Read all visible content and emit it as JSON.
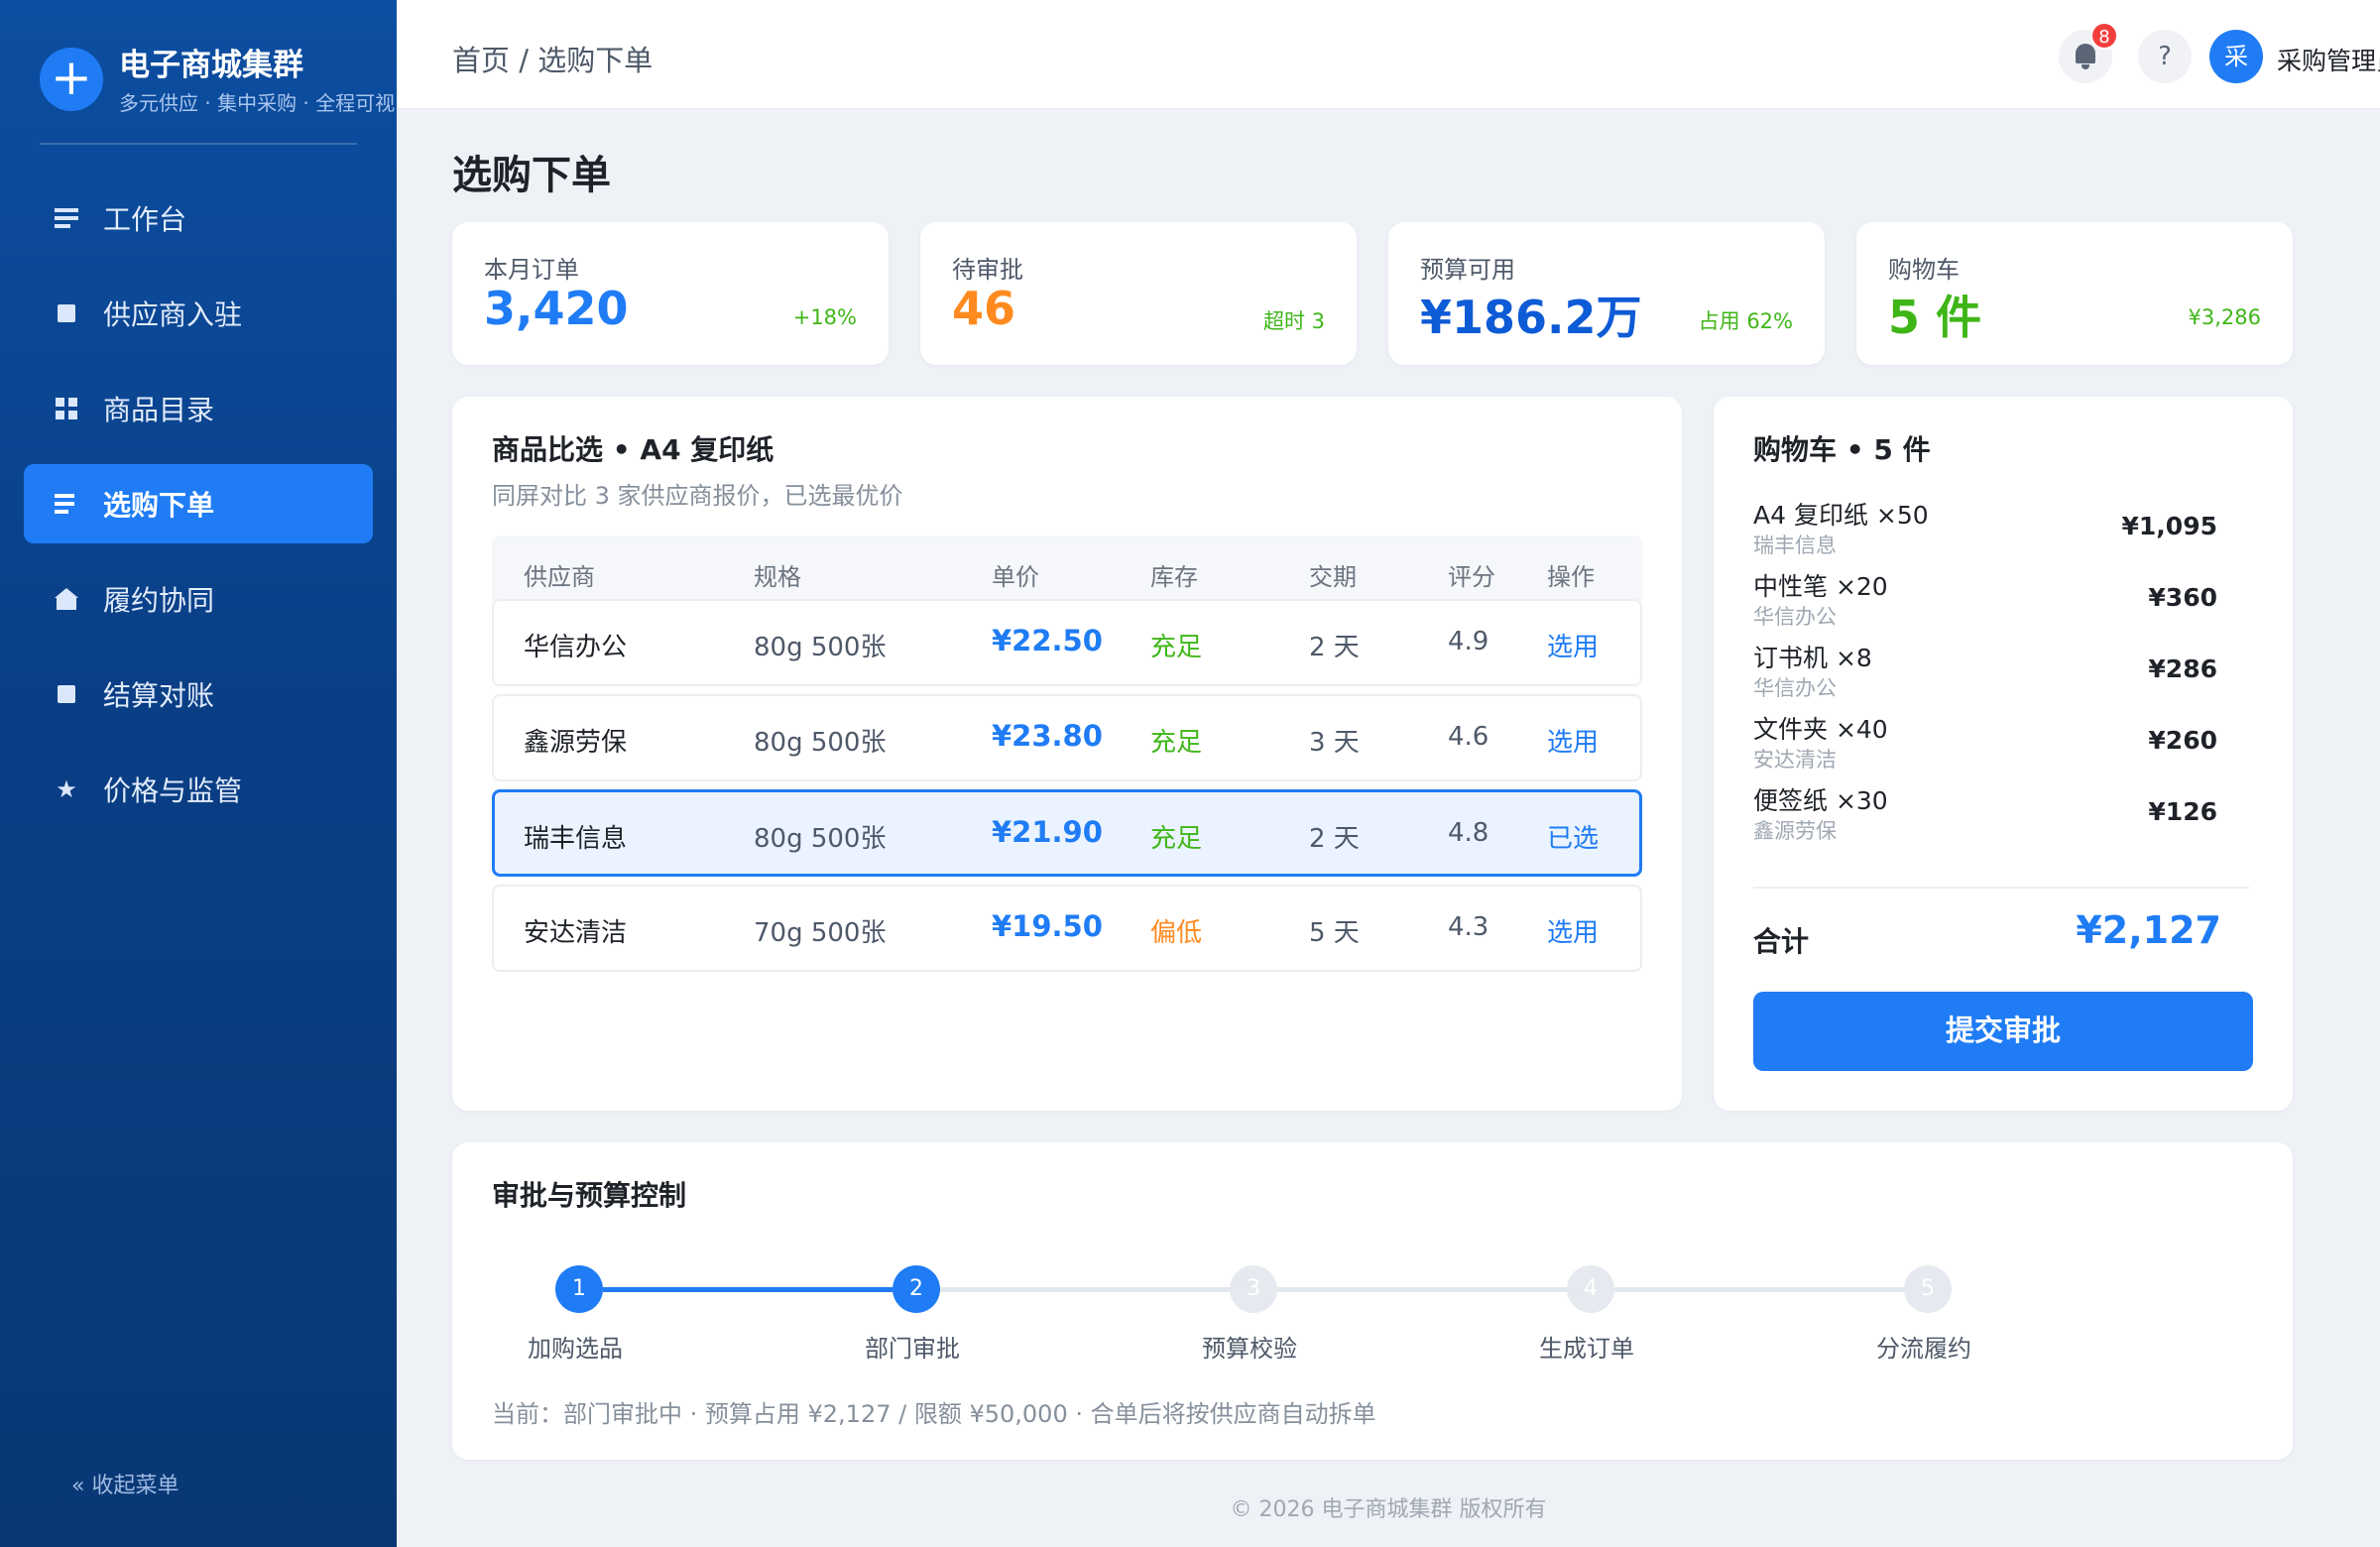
{
  "brand": {
    "title": "电子商城集群",
    "subtitle": "多元供应 · 集中采购 · 全程可视",
    "logo": "+"
  },
  "nav": [
    {
      "label": "工作台",
      "icon": "list-icon"
    },
    {
      "label": "供应商入驻",
      "icon": "square-icon"
    },
    {
      "label": "商品目录",
      "icon": "grid-icon"
    },
    {
      "label": "选购下单",
      "icon": "list-icon",
      "active": true
    },
    {
      "label": "履约协同",
      "icon": "house-icon"
    },
    {
      "label": "结算对账",
      "icon": "square-icon"
    },
    {
      "label": "价格与监管",
      "icon": "star-icon"
    }
  ],
  "collapse_label": "« 收起菜单",
  "header": {
    "breadcrumb": "首页 / 选购下单",
    "notification_count": "8",
    "help": "?",
    "avatar_initial": "采",
    "username": "采购管理员"
  },
  "page_title": "选购下单",
  "stats": [
    {
      "label": "本月订单",
      "value": "3,420",
      "meta": "+18%",
      "value_color": "#1f7cf5",
      "meta_color": "#3fb618"
    },
    {
      "label": "待审批",
      "value": "46",
      "meta": "超时 3",
      "value_color": "#ff8a1f",
      "meta_color": "#3fb618"
    },
    {
      "label": "预算可用",
      "value": "¥186.2万",
      "meta": "占用 62%",
      "value_color": "#0e5bd6",
      "meta_color": "#3fb618"
    },
    {
      "label": "购物车",
      "value": "5 件",
      "meta": "¥3,286",
      "value_color": "#3fb618",
      "meta_color": "#3fb618"
    }
  ],
  "compare": {
    "title": "商品比选 • A4 复印纸",
    "subtitle": "同屏对比 3 家供应商报价，已选最优价",
    "columns": [
      "供应商",
      "规格",
      "单价",
      "库存",
      "交期",
      "评分",
      "操作"
    ],
    "rows": [
      {
        "supplier": "华信办公",
        "spec": "80g 500张",
        "price": "¥22.50",
        "stock": "充足",
        "stock_level": "ok",
        "lead": "2 天",
        "rating": "4.9",
        "action": "选用"
      },
      {
        "supplier": "鑫源劳保",
        "spec": "80g 500张",
        "price": "¥23.80",
        "stock": "充足",
        "stock_level": "ok",
        "lead": "3 天",
        "rating": "4.6",
        "action": "选用"
      },
      {
        "supplier": "瑞丰信息",
        "spec": "80g 500张",
        "price": "¥21.90",
        "stock": "充足",
        "stock_level": "ok",
        "lead": "2 天",
        "rating": "4.8",
        "action": "已选",
        "selected": true
      },
      {
        "supplier": "安达清洁",
        "spec": "70g 500张",
        "price": "¥19.50",
        "stock": "偏低",
        "stock_level": "low",
        "lead": "5 天",
        "rating": "4.3",
        "action": "选用"
      }
    ]
  },
  "cart": {
    "title": "购物车 • 5 件",
    "items": [
      {
        "name": "A4 复印纸 ×50",
        "supplier": "瑞丰信息",
        "price": "¥1,095"
      },
      {
        "name": "中性笔 ×20",
        "supplier": "华信办公",
        "price": "¥360"
      },
      {
        "name": "订书机 ×8",
        "supplier": "华信办公",
        "price": "¥286"
      },
      {
        "name": "文件夹 ×40",
        "supplier": "安达清洁",
        "price": "¥260"
      },
      {
        "name": "便签纸 ×30",
        "supplier": "鑫源劳保",
        "price": "¥126"
      }
    ],
    "total_label": "合计",
    "total_value": "¥2,127",
    "submit_label": "提交审批"
  },
  "approval": {
    "title": "审批与预算控制",
    "steps": [
      {
        "num": "1",
        "label": "加购选品",
        "done": true
      },
      {
        "num": "2",
        "label": "部门审批",
        "done": true
      },
      {
        "num": "3",
        "label": "预算校验",
        "done": false
      },
      {
        "num": "4",
        "label": "生成订单",
        "done": false
      },
      {
        "num": "5",
        "label": "分流履约",
        "done": false
      }
    ],
    "note": "当前：部门审批中 · 预算占用 ¥2,127 / 限额 ¥50,000 · 合单后将按供应商自动拆单"
  },
  "footer": "© 2026 电子商城集群 版权所有",
  "colors": {
    "accent": "#1f7cf5",
    "sidebar": "#0b4592",
    "success": "#3fb618",
    "warning": "#ff8a1f",
    "danger": "#f53f3f"
  }
}
